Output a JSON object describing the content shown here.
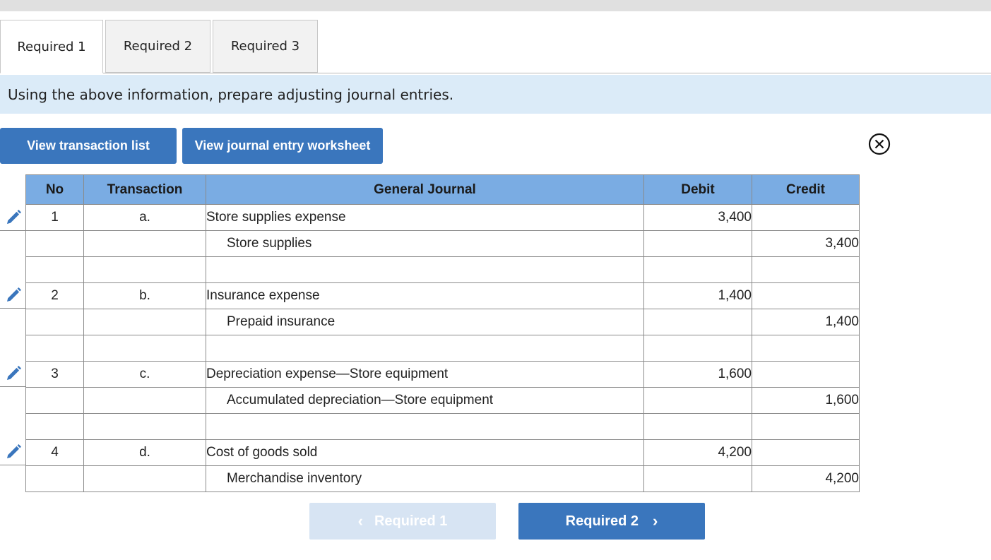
{
  "tabs": [
    {
      "label": "Required 1",
      "active": true
    },
    {
      "label": "Required 2",
      "active": false
    },
    {
      "label": "Required 3",
      "active": false
    }
  ],
  "instruction": "Using the above information, prepare adjusting journal entries.",
  "buttons": {
    "view_transaction_list": "View transaction list",
    "view_journal_worksheet": "View journal entry worksheet"
  },
  "table": {
    "headers": {
      "no": "No",
      "transaction": "Transaction",
      "journal": "General Journal",
      "debit": "Debit",
      "credit": "Credit"
    },
    "rows": [
      {
        "no": "1",
        "transaction": "a.",
        "account": "Store supplies expense",
        "debit": "3,400",
        "credit": ""
      },
      {
        "no": "",
        "transaction": "",
        "account": "Store supplies",
        "debit": "",
        "credit": "3,400"
      },
      {
        "no": "",
        "transaction": "",
        "account": "",
        "debit": "",
        "credit": ""
      },
      {
        "no": "2",
        "transaction": "b.",
        "account": "Insurance expense",
        "debit": "1,400",
        "credit": ""
      },
      {
        "no": "",
        "transaction": "",
        "account": "Prepaid insurance",
        "debit": "",
        "credit": "1,400"
      },
      {
        "no": "",
        "transaction": "",
        "account": "",
        "debit": "",
        "credit": ""
      },
      {
        "no": "3",
        "transaction": "c.",
        "account": "Depreciation expense—Store equipment",
        "debit": "1,600",
        "credit": ""
      },
      {
        "no": "",
        "transaction": "",
        "account": "Accumulated depreciation—Store equipment",
        "debit": "",
        "credit": "1,600"
      },
      {
        "no": "",
        "transaction": "",
        "account": "",
        "debit": "",
        "credit": ""
      },
      {
        "no": "4",
        "transaction": "d.",
        "account": "Cost of goods sold",
        "debit": "4,200",
        "credit": ""
      },
      {
        "no": "",
        "transaction": "",
        "account": "Merchandise inventory",
        "debit": "",
        "credit": "4,200"
      }
    ]
  },
  "navigation": {
    "prev_label": "Required 1",
    "next_label": "Required 2",
    "prev_chevron": "‹",
    "next_chevron": "›"
  },
  "colors": {
    "accent": "#3a76bd",
    "header_bg": "#7aace3",
    "banner_bg": "#dbebf8",
    "disabled_bg": "#d7e4f3"
  }
}
